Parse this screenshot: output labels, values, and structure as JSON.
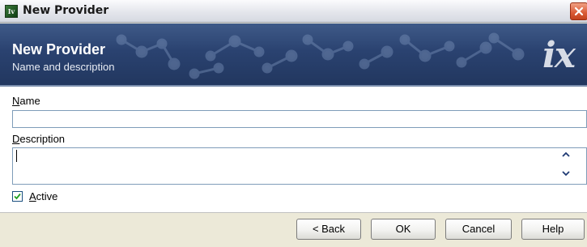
{
  "window": {
    "title": "New Provider",
    "app_icon_text": "Iv",
    "close_icon": "close-icon"
  },
  "banner": {
    "title": "New Provider",
    "subtitle": "Name and description",
    "logo": "ix"
  },
  "form": {
    "name_label_mnemonic": "N",
    "name_label_rest": "ame",
    "name_value": "",
    "description_label_mnemonic": "D",
    "description_label_rest": "escription",
    "description_value": "",
    "scroll_up_icon": "chevron-up-icon",
    "scroll_down_icon": "chevron-down-icon",
    "active_label_mnemonic": "A",
    "active_label_rest": "ctive",
    "active_checked": true
  },
  "buttons": {
    "back": "< Back",
    "ok": "OK",
    "cancel": "Cancel",
    "help": "Help"
  },
  "colors": {
    "banner_dark": "#22375f",
    "banner_light": "#3f5a88",
    "close_red": "#d95a35",
    "field_border": "#7f9db9"
  }
}
